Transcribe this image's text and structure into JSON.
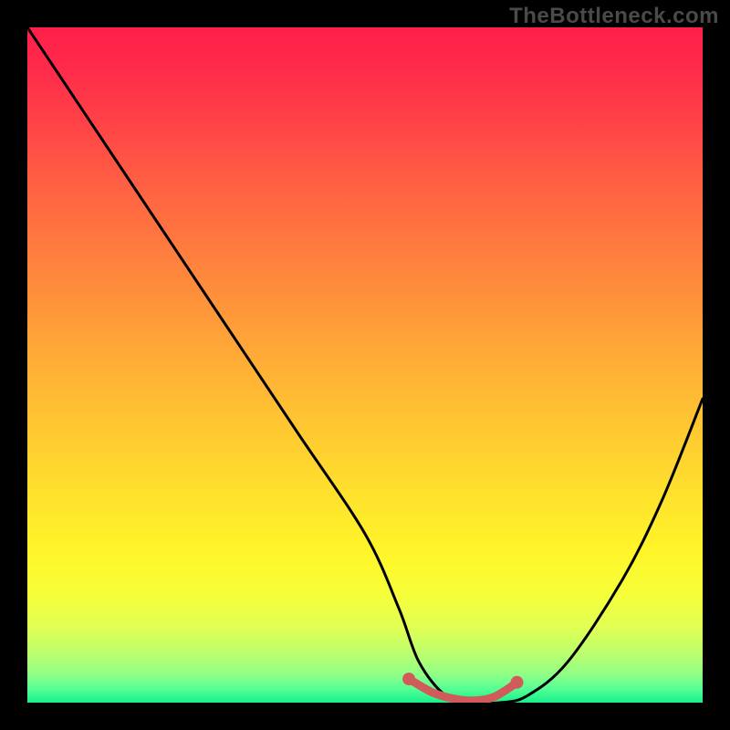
{
  "watermark": "TheBottleneck.com",
  "chart_data": {
    "type": "line",
    "title": "",
    "xlabel": "",
    "ylabel": "",
    "xlim": [
      0,
      100
    ],
    "ylim": [
      0,
      100
    ],
    "grid": false,
    "series": [
      {
        "name": "bottleneck-curve",
        "color": "#000000",
        "x": [
          0,
          10,
          20,
          30,
          40,
          50,
          55,
          58,
          62,
          66,
          70,
          74,
          80,
          88,
          94,
          100
        ],
        "values": [
          100,
          85,
          70,
          55,
          40,
          25,
          14,
          6,
          1,
          0,
          0,
          1,
          6,
          18,
          30,
          45
        ]
      }
    ],
    "markers": [
      {
        "name": "flat-region-start",
        "x": 56.5,
        "y": 3.5,
        "color": "#d15a5a"
      },
      {
        "name": "flat-region-end",
        "x": 72.5,
        "y": 3.0,
        "color": "#d15a5a"
      }
    ],
    "highlight_segment": {
      "name": "optimal-range",
      "color": "#d15a5a",
      "x": [
        57,
        60,
        63,
        66,
        69,
        72
      ],
      "values": [
        3.2,
        1.5,
        0.6,
        0.3,
        0.8,
        2.6
      ]
    },
    "background_gradient": {
      "top": "#ff1f4a",
      "bottom": "#18f08a",
      "stops": [
        "red",
        "orange",
        "yellow",
        "green"
      ]
    }
  }
}
